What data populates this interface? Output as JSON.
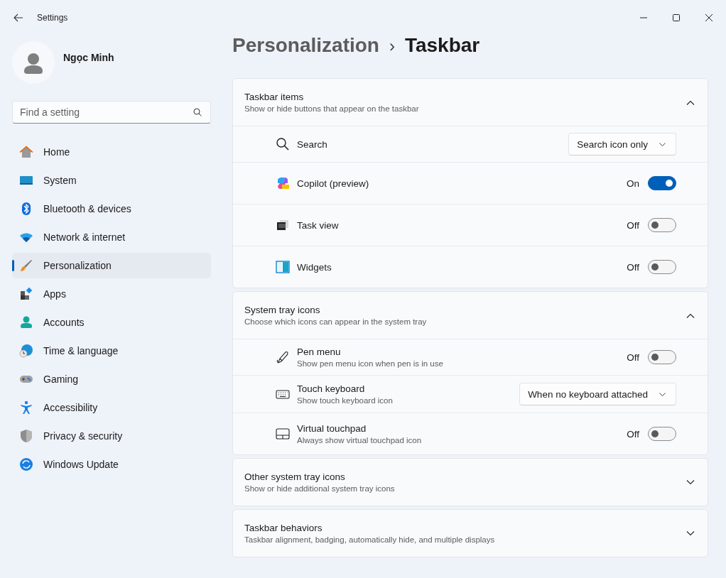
{
  "window": {
    "title": "Settings"
  },
  "user": {
    "name": "Ngọc Minh"
  },
  "search": {
    "placeholder": "Find a setting"
  },
  "nav": [
    {
      "label": "Home",
      "selected": false
    },
    {
      "label": "System",
      "selected": false
    },
    {
      "label": "Bluetooth & devices",
      "selected": false
    },
    {
      "label": "Network & internet",
      "selected": false
    },
    {
      "label": "Personalization",
      "selected": true
    },
    {
      "label": "Apps",
      "selected": false
    },
    {
      "label": "Accounts",
      "selected": false
    },
    {
      "label": "Time & language",
      "selected": false
    },
    {
      "label": "Gaming",
      "selected": false
    },
    {
      "label": "Accessibility",
      "selected": false
    },
    {
      "label": "Privacy & security",
      "selected": false
    },
    {
      "label": "Windows Update",
      "selected": false
    }
  ],
  "breadcrumb": {
    "parent": "Personalization",
    "separator": "›",
    "current": "Taskbar"
  },
  "sections": [
    {
      "title": "Taskbar items",
      "subtitle": "Show or hide buttons that appear on the taskbar",
      "expanded": true,
      "rows": [
        {
          "kind": "dropdown",
          "label": "Search",
          "value": "Search icon only"
        },
        {
          "kind": "toggle",
          "label": "Copilot (preview)",
          "on": true,
          "state_label": "On"
        },
        {
          "kind": "toggle",
          "label": "Task view",
          "on": false,
          "state_label": "Off"
        },
        {
          "kind": "toggle",
          "label": "Widgets",
          "on": false,
          "state_label": "Off"
        }
      ]
    },
    {
      "title": "System tray icons",
      "subtitle": "Choose which icons can appear in the system tray",
      "expanded": true,
      "rows": [
        {
          "kind": "toggle",
          "label": "Pen menu",
          "description": "Show pen menu icon when pen is in use",
          "on": false,
          "state_label": "Off"
        },
        {
          "kind": "dropdown",
          "label": "Touch keyboard",
          "description": "Show touch keyboard icon",
          "value": "When no keyboard attached"
        },
        {
          "kind": "toggle",
          "label": "Virtual touchpad",
          "description": "Always show virtual touchpad icon",
          "on": false,
          "state_label": "Off"
        }
      ]
    },
    {
      "title": "Other system tray icons",
      "subtitle": "Show or hide additional system tray icons",
      "expanded": false
    },
    {
      "title": "Taskbar behaviors",
      "subtitle": "Taskbar alignment, badging, automatically hide, and multiple displays",
      "expanded": false
    }
  ]
}
